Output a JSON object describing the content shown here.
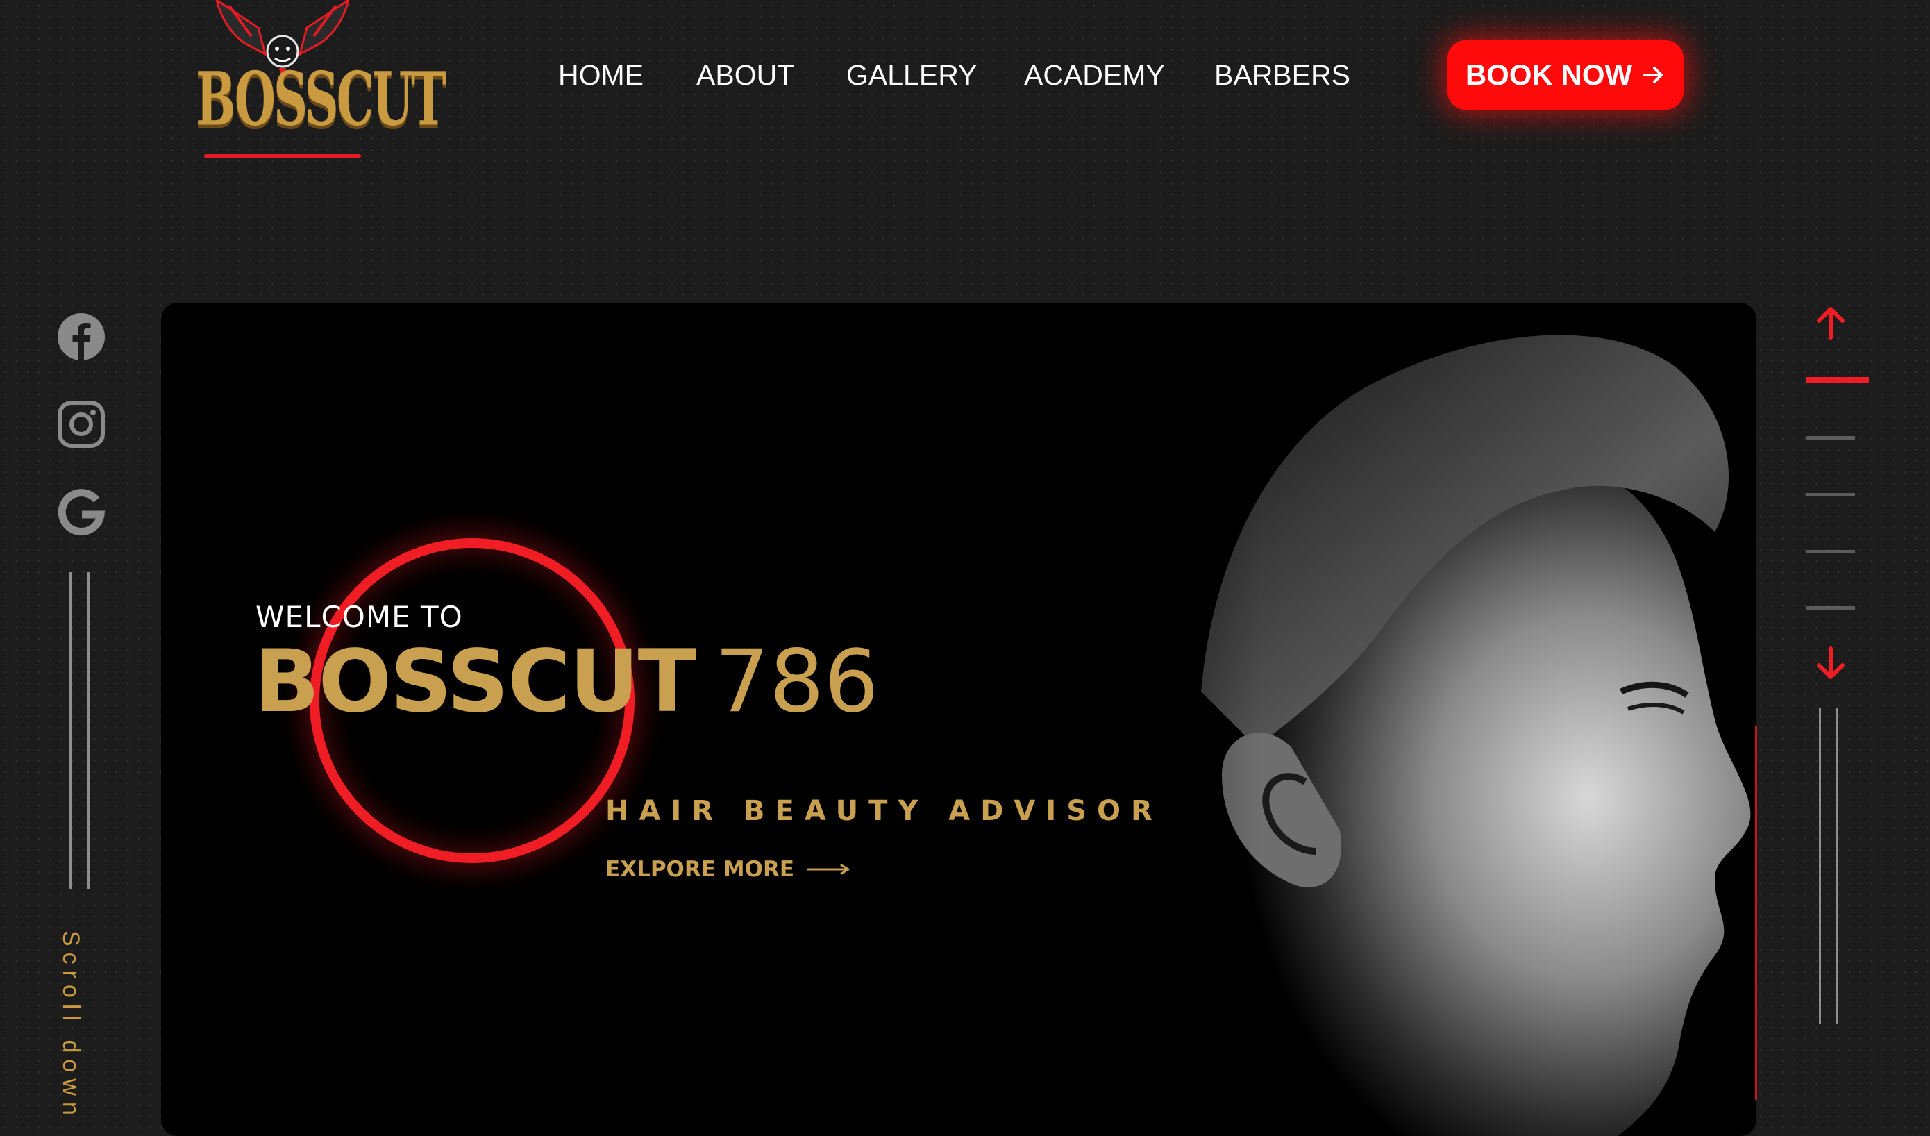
{
  "header": {
    "logo_text": "BOSSCUT",
    "nav": [
      {
        "label": "HOME"
      },
      {
        "label": "ABOUT"
      },
      {
        "label": "GALLERY"
      },
      {
        "label": "ACADEMY"
      },
      {
        "label": "BARBERS"
      }
    ],
    "cta_label": "BOOK NOW",
    "cta_icon": "arrow-right-icon"
  },
  "social": [
    {
      "name": "facebook-icon"
    },
    {
      "name": "instagram-icon"
    },
    {
      "name": "google-icon"
    }
  ],
  "scroll_label": "Scroll down",
  "hero": {
    "welcome": "WELCOME TO",
    "brand": "BOSSCUT",
    "brand_number": "786",
    "tagline": "HAIR BEAUTY ADVISOR",
    "explore_label": "EXLPORE MORE"
  },
  "slider": {
    "slide_count": 5,
    "active_index": 0,
    "up_icon": "arrow-up-icon",
    "down_icon": "arrow-down-icon"
  },
  "colors": {
    "accent_red": "#f01e24",
    "gold": "#c9a04f",
    "background": "#1c1c1c"
  }
}
